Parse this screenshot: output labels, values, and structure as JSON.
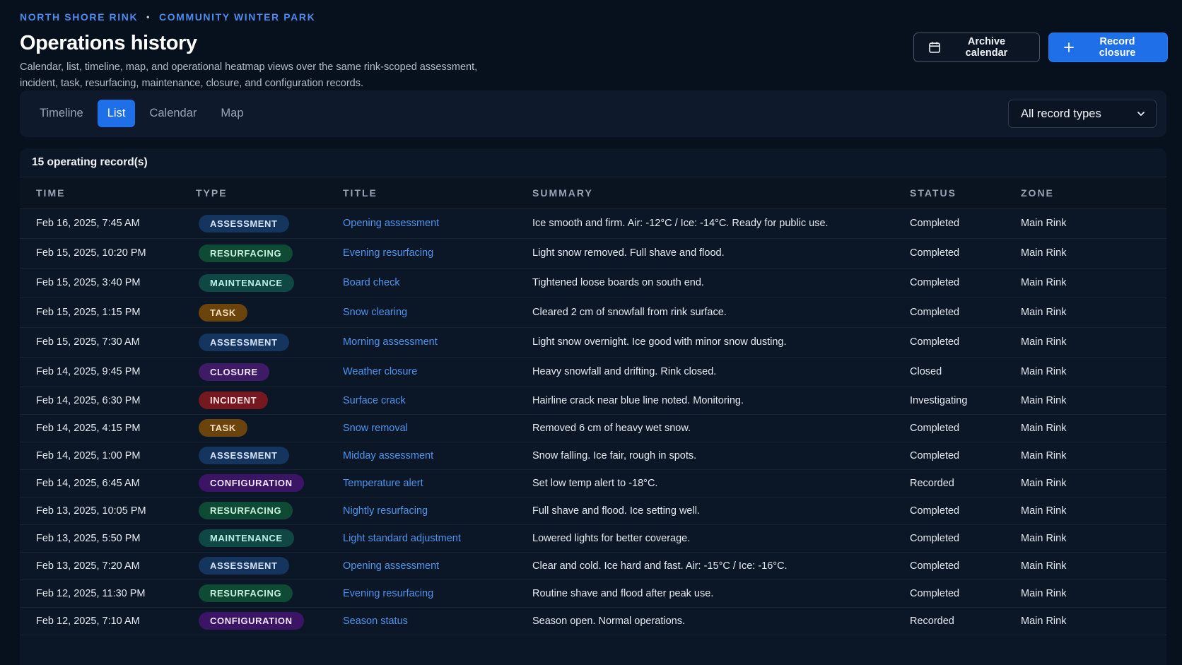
{
  "header": {
    "breadcrumb": [
      "NORTH SHORE RINK",
      "COMMUNITY WINTER PARK"
    ],
    "separator": "•",
    "title": "Operations history",
    "description": "Calendar, list, timeline, map, and operational heatmap views over the same rink-scoped assessment, incident, task, resurfacing, maintenance, closure, and configuration records."
  },
  "actions": {
    "archive_label": "Archive calendar",
    "archive_icon": "calendar-icon",
    "record_label": "Record closure",
    "record_icon": "plus-icon"
  },
  "views": {
    "tabs": [
      "Timeline",
      "List",
      "Calendar",
      "Map"
    ],
    "active": "List",
    "filter_value": "All record types"
  },
  "panel": {
    "count_label": "15 operating record(s)",
    "columns": [
      "TIME",
      "TYPE",
      "TITLE",
      "SUMMARY",
      "STATUS",
      "ZONE"
    ],
    "rows": [
      {
        "time": "Feb 16, 2025, 7:45 AM",
        "type": "ASSESSMENT",
        "title": "Opening assessment",
        "summary": "Ice smooth and firm. Air: -12°C / Ice: -14°C. Ready for public use.",
        "status": "Completed",
        "zone": "Main Rink"
      },
      {
        "time": "Feb 15, 2025, 10:20 PM",
        "type": "RESURFACING",
        "title": "Evening resurfacing",
        "summary": "Light snow removed. Full shave and flood.",
        "status": "Completed",
        "zone": "Main Rink"
      },
      {
        "time": "Feb 15, 2025, 3:40 PM",
        "type": "MAINTENANCE",
        "title": "Board check",
        "summary": "Tightened loose boards on south end.",
        "status": "Completed",
        "zone": "Main Rink"
      },
      {
        "time": "Feb 15, 2025, 1:15 PM",
        "type": "TASK",
        "title": "Snow clearing",
        "summary": "Cleared 2 cm of snowfall from rink surface.",
        "status": "Completed",
        "zone": "Main Rink"
      },
      {
        "time": "Feb 15, 2025, 7:30 AM",
        "type": "ASSESSMENT",
        "title": "Morning assessment",
        "summary": "Light snow overnight. Ice good with minor snow dusting.",
        "status": "Completed",
        "zone": "Main Rink"
      },
      {
        "time": "Feb 14, 2025, 9:45 PM",
        "type": "CLOSURE",
        "title": "Weather closure",
        "summary": "Heavy snowfall and drifting. Rink closed.",
        "status": "Closed",
        "zone": "Main Rink"
      },
      {
        "time": "Feb 14, 2025, 6:30 PM",
        "type": "INCIDENT",
        "title": "Surface crack",
        "summary": "Hairline crack near blue line noted. Monitoring.",
        "status": "Investigating",
        "zone": "Main Rink"
      },
      {
        "time": "Feb 14, 2025, 4:15 PM",
        "type": "TASK",
        "title": "Snow removal",
        "summary": "Removed 6 cm of heavy wet snow.",
        "status": "Completed",
        "zone": "Main Rink"
      },
      {
        "time": "Feb 14, 2025, 1:00 PM",
        "type": "ASSESSMENT",
        "title": "Midday assessment",
        "summary": "Snow falling. Ice fair, rough in spots.",
        "status": "Completed",
        "zone": "Main Rink"
      },
      {
        "time": "Feb 14, 2025, 6:45 AM",
        "type": "CONFIGURATION",
        "title": "Temperature alert",
        "summary": "Set low temp alert to -18°C.",
        "status": "Recorded",
        "zone": "Main Rink"
      },
      {
        "time": "Feb 13, 2025, 10:05 PM",
        "type": "RESURFACING",
        "title": "Nightly resurfacing",
        "summary": "Full shave and flood. Ice setting well.",
        "status": "Completed",
        "zone": "Main Rink"
      },
      {
        "time": "Feb 13, 2025, 5:50 PM",
        "type": "MAINTENANCE",
        "title": "Light standard adjustment",
        "summary": "Lowered lights for better coverage.",
        "status": "Completed",
        "zone": "Main Rink"
      },
      {
        "time": "Feb 13, 2025, 7:20 AM",
        "type": "ASSESSMENT",
        "title": "Opening assessment",
        "summary": "Clear and cold. Ice hard and fast. Air: -15°C / Ice: -16°C.",
        "status": "Completed",
        "zone": "Main Rink"
      },
      {
        "time": "Feb 12, 2025, 11:30 PM",
        "type": "RESURFACING",
        "title": "Evening resurfacing",
        "summary": "Routine shave and flood after peak use.",
        "status": "Completed",
        "zone": "Main Rink"
      },
      {
        "time": "Feb 12, 2025, 7:10 AM",
        "type": "CONFIGURATION",
        "title": "Season status",
        "summary": "Season open. Normal operations.",
        "status": "Recorded",
        "zone": "Main Rink"
      }
    ]
  }
}
